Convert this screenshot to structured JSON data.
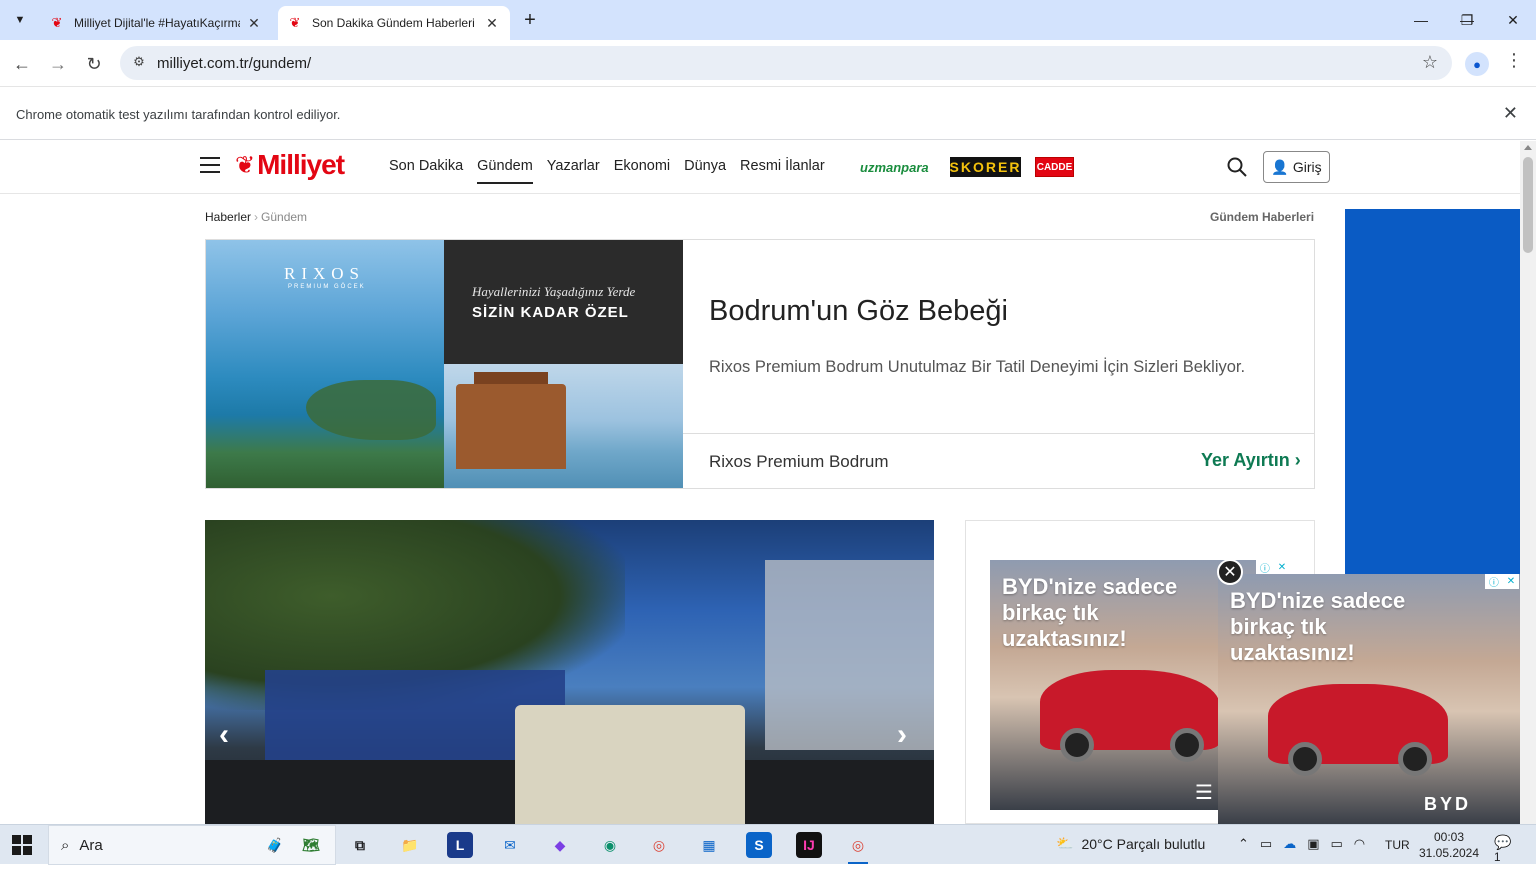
{
  "browser": {
    "tabs": [
      {
        "title": "Milliyet Dijital'le #HayatıKaçırma",
        "active": false
      },
      {
        "title": "Son Dakika Gündem Haberleri -",
        "active": true
      }
    ],
    "new_tab": "+",
    "url": "milliyet.com.tr/gundem/",
    "infobar_message": "Chrome otomatik test yazılımı tarafından kontrol ediliyor.",
    "window_controls": [
      "minimize",
      "restore",
      "close"
    ]
  },
  "site": {
    "logo": "Milliyet",
    "nav": [
      {
        "label": "Son Dakika",
        "active": false
      },
      {
        "label": "Gündem",
        "active": true
      },
      {
        "label": "Yazarlar",
        "active": false
      },
      {
        "label": "Ekonomi",
        "active": false
      },
      {
        "label": "Dünya",
        "active": false
      },
      {
        "label": "Resmi İlanlar",
        "active": false
      }
    ],
    "partners": {
      "uzmanpara": "uzmanpara",
      "skorer": "SKORER",
      "cadde": "CADDE"
    },
    "login_label": "Giriş",
    "breadcrumb": {
      "root": "Haberler",
      "current": "Gündem"
    },
    "section_title": "Gündem Haberleri"
  },
  "ad_rixos": {
    "brand": "RIXOS",
    "brand_sub": "PREMIUM GÖCEK",
    "tagline": "Hayallerinizi Yaşadığınız Yerde",
    "tagline_bold": "SİZİN KADAR ÖZEL",
    "headline": "Bodrum'un Göz Bebeği",
    "description": "Rixos Premium Bodrum Unutulmaz Bir Tatil Deneyimi İçin Sizleri Bekliyor.",
    "advertiser": "Rixos Premium Bodrum",
    "cta": "Yer Ayırtın"
  },
  "ad_byd": {
    "line1": "BYD'nize sadece",
    "line2": "birkaç tık",
    "line3": "uzaktasınız!",
    "logo": "BYD"
  },
  "taskbar": {
    "search_label": "Ara",
    "weather": "20°C  Parçalı bulutlu",
    "language": "TUR",
    "time": "00:03",
    "date": "31.05.2024",
    "notification_count": "1"
  },
  "colors": {
    "brand_red": "#e30613",
    "accent_green": "#0e7a53",
    "chrome_tab_bg": "#d3e3fd"
  }
}
